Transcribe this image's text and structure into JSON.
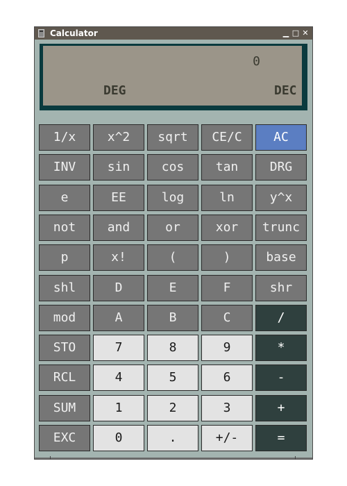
{
  "window": {
    "title": "Calculator",
    "controls": {
      "minimize": "▁",
      "maximize": "□",
      "close": "✕"
    }
  },
  "display": {
    "value": "0",
    "angle_mode": "DEG",
    "number_base": "DEC"
  },
  "colors": {
    "window_bg": "#a3b4b0",
    "lcd_bg": "#9b9589",
    "lcd_frame": "#0a3a3e",
    "function_key": "#767676",
    "digit_key": "#e3e3e3",
    "operator_key": "#2f403e",
    "accent_key": "#5b7ec2"
  },
  "keys": [
    [
      "1/x",
      "x^2",
      "sqrt",
      "CE/C",
      "AC"
    ],
    [
      "INV",
      "sin",
      "cos",
      "tan",
      "DRG"
    ],
    [
      "e",
      "EE",
      "log",
      "ln",
      "y^x"
    ],
    [
      "not",
      "and",
      "or",
      "xor",
      "trunc"
    ],
    [
      "p",
      "x!",
      "(",
      ")",
      "base"
    ],
    [
      "shl",
      "D",
      "E",
      "F",
      "shr"
    ],
    [
      "mod",
      "A",
      "B",
      "C",
      "/"
    ],
    [
      "STO",
      "7",
      "8",
      "9",
      "*"
    ],
    [
      "RCL",
      "4",
      "5",
      "6",
      "-"
    ],
    [
      "SUM",
      "1",
      "2",
      "3",
      "+"
    ],
    [
      "EXC",
      "0",
      ".",
      "+/-",
      "="
    ]
  ]
}
